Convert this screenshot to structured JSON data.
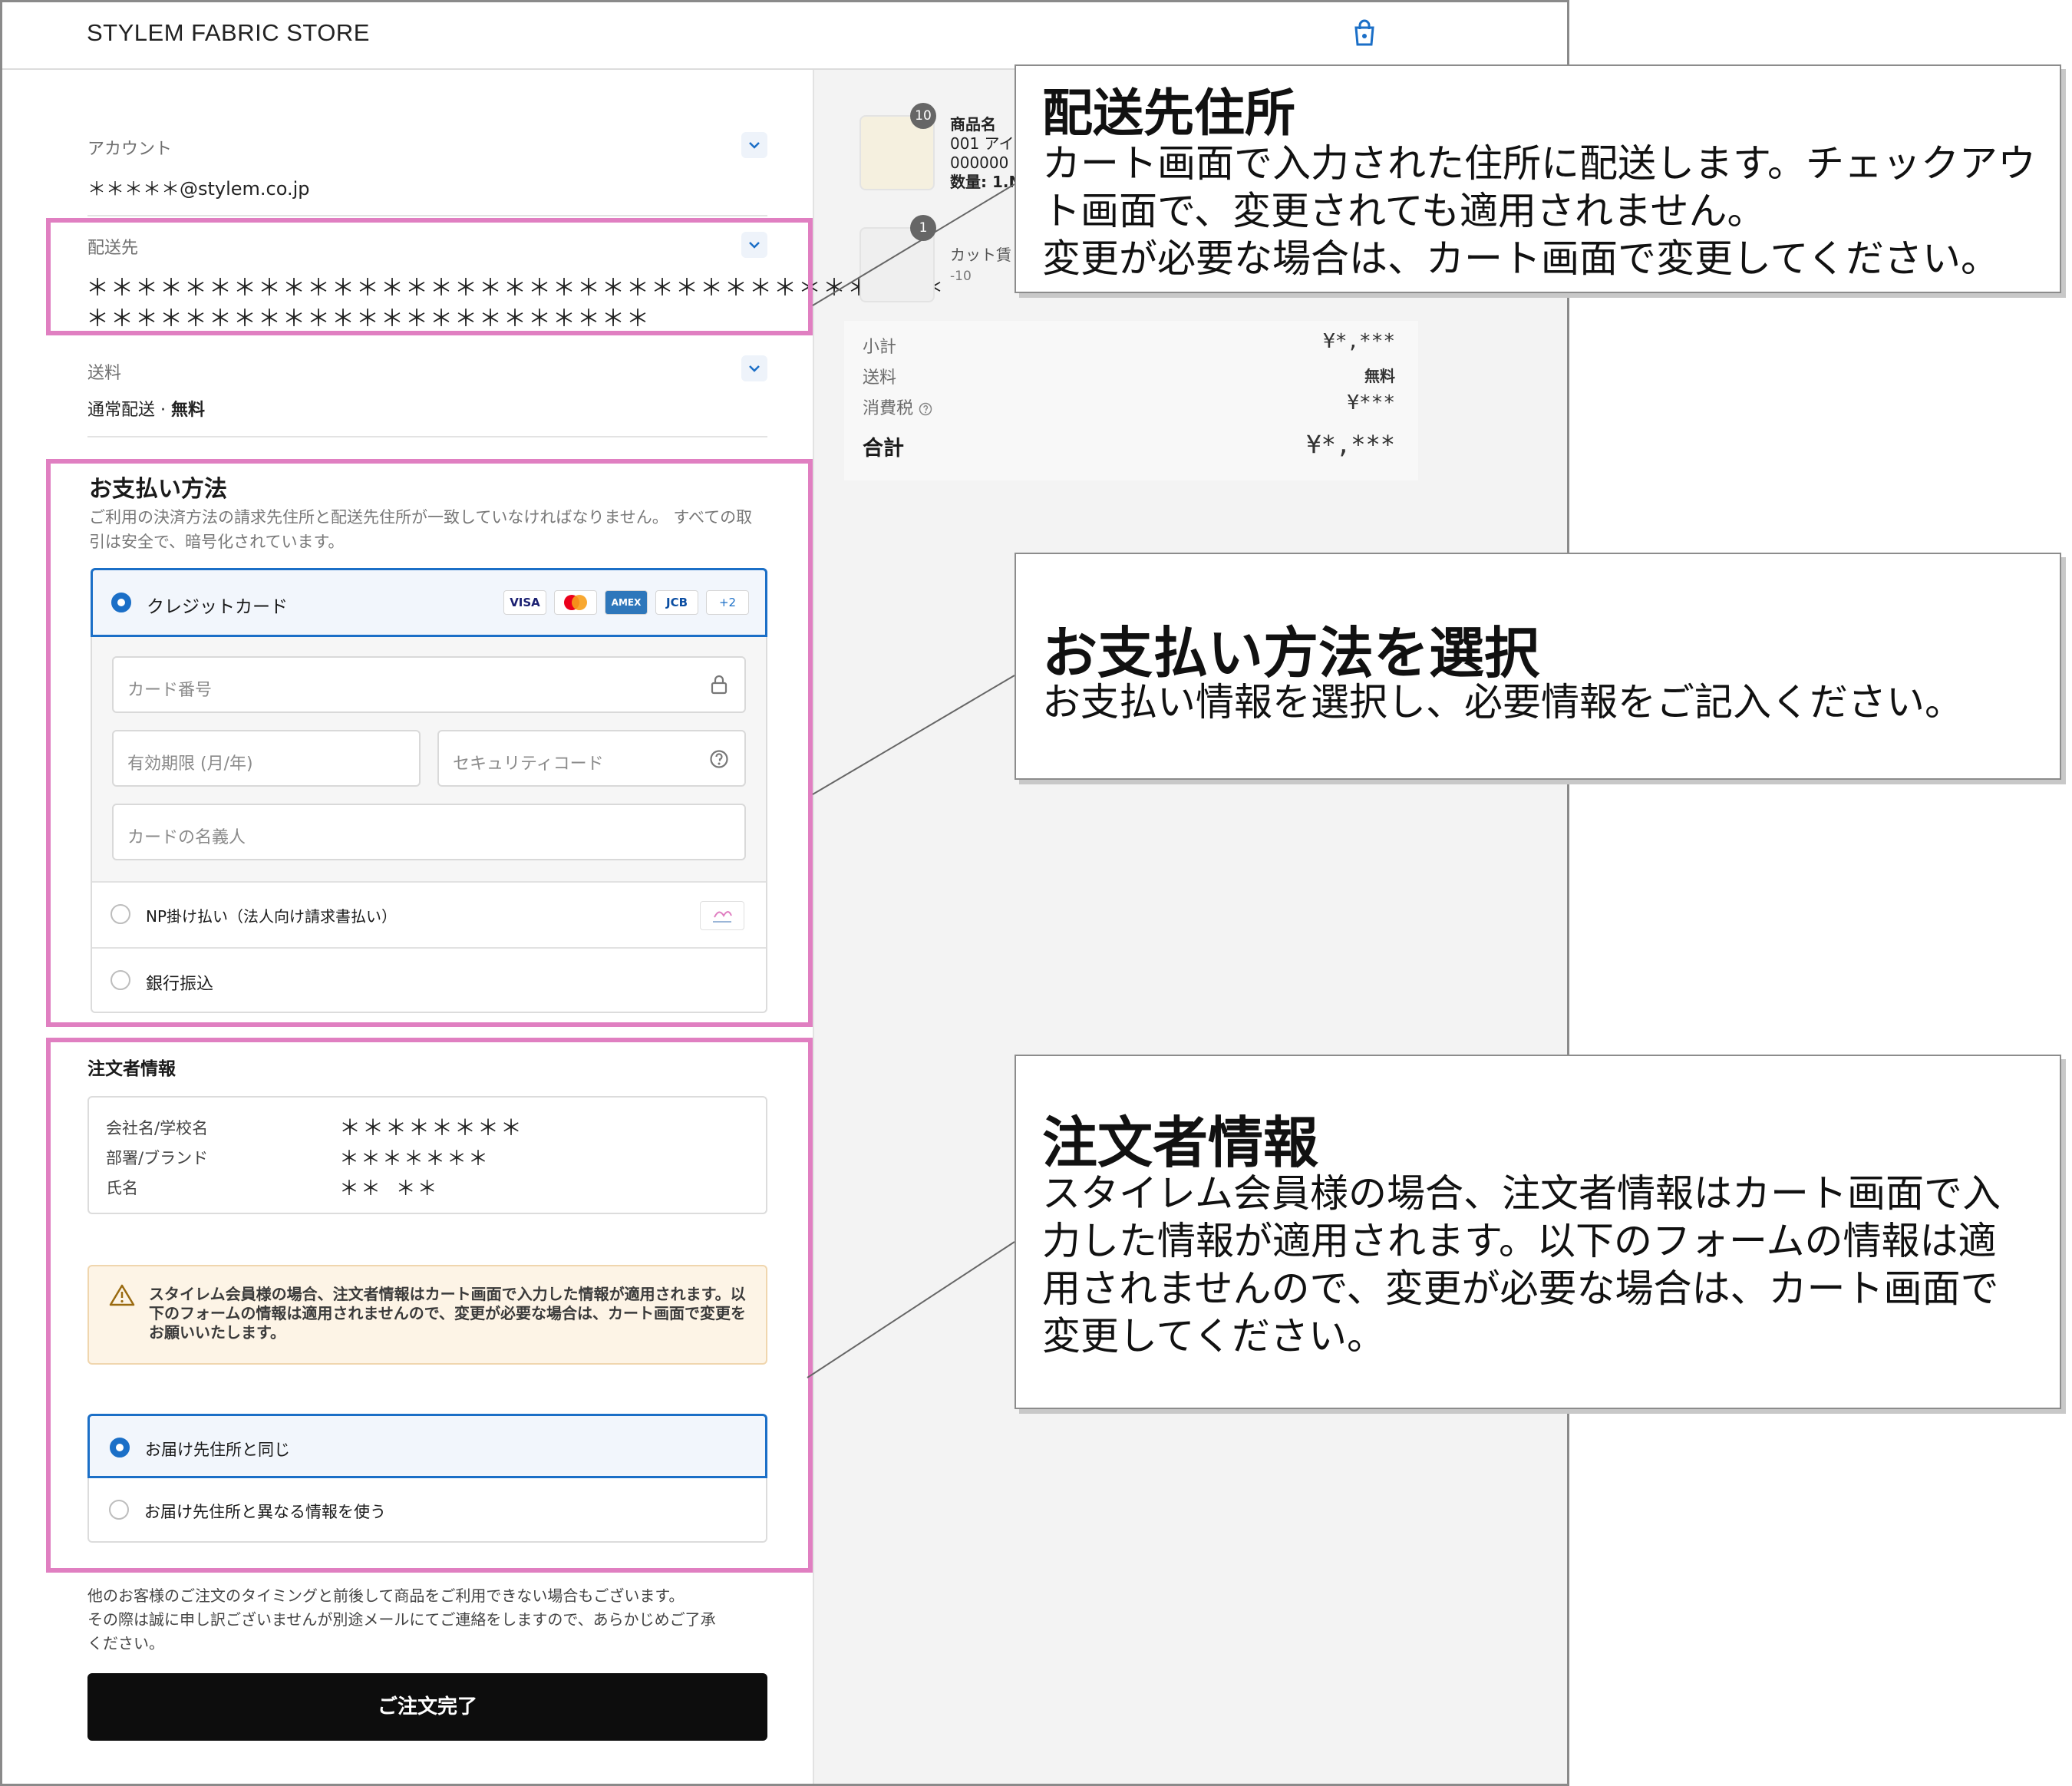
{
  "header": {
    "store_name": "STYLEM FABRIC STORE",
    "cart_icon": "shopping-bag-icon"
  },
  "account": {
    "label": "アカウント",
    "value": "＊＊＊＊＊@stylem.co.jp"
  },
  "shipping_address": {
    "label": "配送先",
    "line1": "＊＊＊＊＊＊＊＊＊＊＊＊＊＊＊＊＊＊＊＊＊＊＊＊＊＊＊＊＊＊＊＊＊＊＊",
    "line2": "＊＊＊＊＊＊＊＊＊＊＊＊＊＊＊＊＊＊＊＊＊＊＊"
  },
  "shipping_fee": {
    "label": "送料",
    "method": "通常配送 · ",
    "price": "無料"
  },
  "payment": {
    "title": "お支払い方法",
    "description": "ご利用の決済方法の請求先住所と配送先住所が一致していなければなりません。 すべての取引は安全で、暗号化されています。",
    "credit_card_label": "クレジットカード",
    "card_logos": [
      "VISA",
      "MC",
      "AMEX",
      "JCB",
      "+2"
    ],
    "card_number_placeholder": "カード番号",
    "expiry_placeholder": "有効期限 (月/年)",
    "security_code_placeholder": "セキュリティコード",
    "cardholder_placeholder": "カードの名義人",
    "np_label": "NP掛け払い（法人向け請求書払い）",
    "bank_label": "銀行振込"
  },
  "orderer": {
    "title": "注文者情報",
    "rows": [
      {
        "label": "会社名/学校名",
        "value": "＊＊＊＊＊＊＊＊"
      },
      {
        "label": "部署/ブランド",
        "value": "＊＊＊＊＊＊＊"
      },
      {
        "label": "氏名",
        "value": "＊＊ ＊＊"
      }
    ],
    "warning": "スタイレム会員様の場合、注文者情報はカート画面で入力した情報が適用されます。以下のフォームの情報は適用されませんので、変更が必要な場合は、カート画面で変更をお願いいたします。",
    "option_same": "お届け先住所と同じ",
    "option_different": "お届け先住所と異なる情報を使う"
  },
  "footer_note": {
    "line1": "他のお客様のご注文のタイミングと前後して商品をご利用できない場合もございます。",
    "line2": "その際は誠に申し訳ございませんが別途メールにてご連絡をしますので、あらかじめご了承",
    "line3": "ください。"
  },
  "submit_button": "ご注文完了",
  "cart_items": [
    {
      "badge": "10",
      "name": "商品名",
      "code": "001 アイ",
      "sku": "000000",
      "qty": "数量: 1.N"
    },
    {
      "badge": "1",
      "name": "カット賃",
      "sub": "-10"
    }
  ],
  "summary": {
    "subtotal_label": "小計",
    "subtotal_value": "¥*,***",
    "shipping_label": "送料",
    "shipping_value": "無料",
    "tax_label": "消費税",
    "tax_value": "¥***",
    "total_label": "合計",
    "total_value": "¥*,***"
  },
  "callouts": {
    "address": {
      "title": "配送先住所",
      "line1": "カート画面で入力された住所に配送します。チェックアウ",
      "line2": "ト画面で、変更されても適用されません。",
      "line3": "変更が必要な場合は、カート画面で変更してください。"
    },
    "payment": {
      "title": "お支払い方法を選択",
      "line1": "お支払い情報を選択し、必要情報をご記入ください。"
    },
    "orderer": {
      "title": "注文者情報",
      "line1": "スタイレム会員様の場合、注文者情報はカート画面で入",
      "line2": "力した情報が適用されます。以下のフォームの情報は適",
      "line3": "用されませんので、変更が必要な場合は、カート画面で",
      "line4": "変更してください。"
    }
  },
  "colors": {
    "accent": "#1b6fc7",
    "highlight": "#e07fc1",
    "warning_bg": "#fdf4e6",
    "button": "#0d0d0d"
  }
}
